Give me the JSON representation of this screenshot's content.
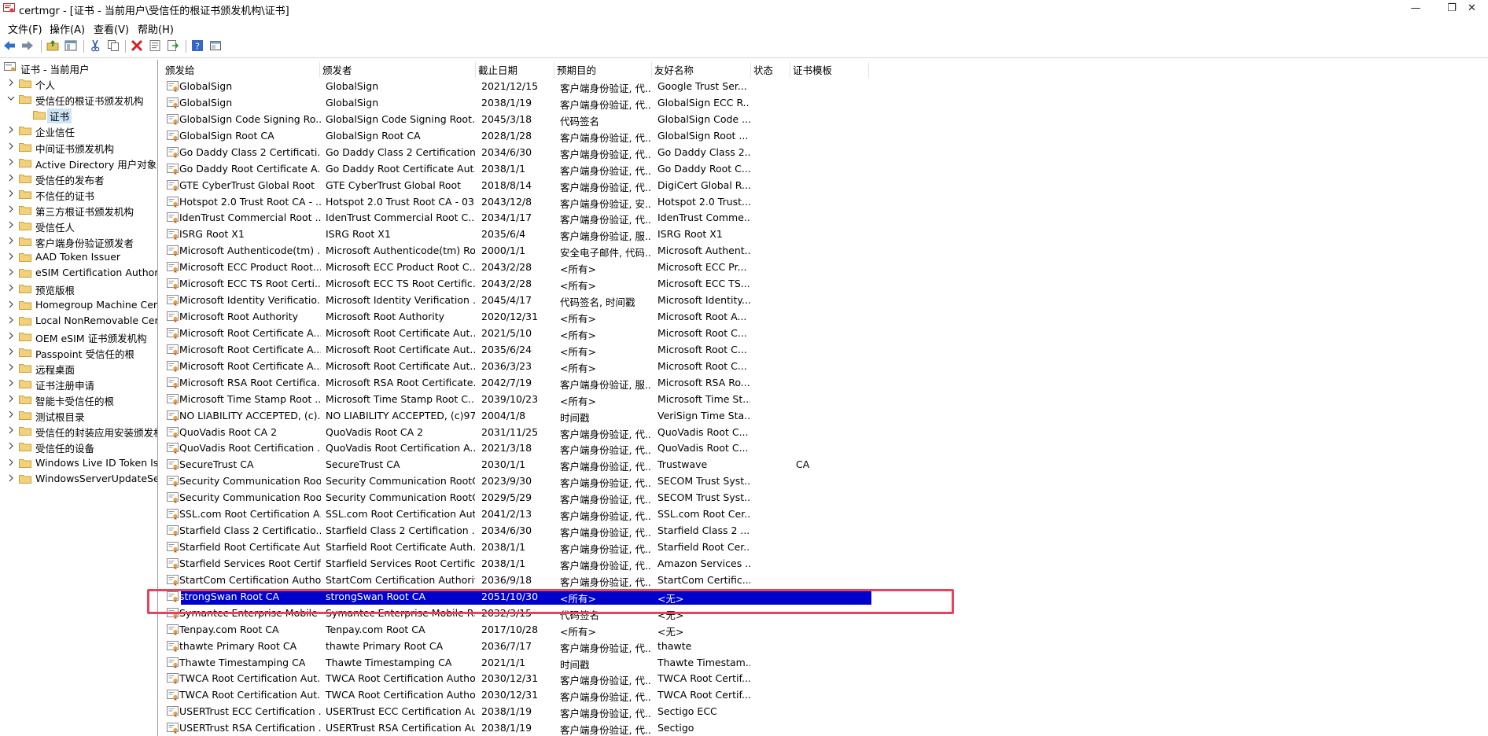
{
  "window": {
    "title": "certmgr - [证书 - 当前用户\\受信任的根证书颁发机构\\证书]",
    "controls": [
      "—",
      "❐",
      "✕"
    ]
  },
  "menu": [
    "文件(F)",
    "操作(A)",
    "查看(V)",
    "帮助(H)"
  ],
  "toolbar": {
    "icons": [
      "back-arrow-icon",
      "forward-arrow-icon",
      "up-folder-icon",
      "show-hide-tree-icon",
      "cut-icon",
      "copy-icon",
      "delete-icon",
      "properties-icon",
      "export-icon",
      "help-icon",
      "view-icon"
    ]
  },
  "tree": [
    {
      "label": "证书 - 当前用户",
      "level": 0,
      "chevron": "none",
      "folder": false,
      "selected": false
    },
    {
      "label": "个人",
      "level": 1,
      "chevron": "right",
      "folder": true,
      "selected": false
    },
    {
      "label": "受信任的根证书颁发机构",
      "level": 1,
      "chevron": "down",
      "folder": true,
      "selected": false
    },
    {
      "label": "证书",
      "level": 2,
      "chevron": "none",
      "folder": true,
      "selected": true
    },
    {
      "label": "企业信任",
      "level": 1,
      "chevron": "right",
      "folder": true,
      "selected": false
    },
    {
      "label": "中间证书颁发机构",
      "level": 1,
      "chevron": "right",
      "folder": true,
      "selected": false
    },
    {
      "label": "Active Directory 用户对象",
      "level": 1,
      "chevron": "right",
      "folder": true,
      "selected": false
    },
    {
      "label": "受信任的发布者",
      "level": 1,
      "chevron": "right",
      "folder": true,
      "selected": false
    },
    {
      "label": "不信任的证书",
      "level": 1,
      "chevron": "right",
      "folder": true,
      "selected": false
    },
    {
      "label": "第三方根证书颁发机构",
      "level": 1,
      "chevron": "right",
      "folder": true,
      "selected": false
    },
    {
      "label": "受信任人",
      "level": 1,
      "chevron": "right",
      "folder": true,
      "selected": false
    },
    {
      "label": "客户端身份验证颁发者",
      "level": 1,
      "chevron": "right",
      "folder": true,
      "selected": false
    },
    {
      "label": "AAD Token Issuer",
      "level": 1,
      "chevron": "right",
      "folder": true,
      "selected": false
    },
    {
      "label": "eSIM Certification Authoriti",
      "level": 1,
      "chevron": "right",
      "folder": true,
      "selected": false
    },
    {
      "label": "预览版根",
      "level": 1,
      "chevron": "right",
      "folder": true,
      "selected": false
    },
    {
      "label": "Homegroup Machine Cert",
      "level": 1,
      "chevron": "right",
      "folder": true,
      "selected": false
    },
    {
      "label": "Local NonRemovable Cert",
      "level": 1,
      "chevron": "right",
      "folder": true,
      "selected": false
    },
    {
      "label": "OEM eSIM 证书颁发机构",
      "level": 1,
      "chevron": "right",
      "folder": true,
      "selected": false
    },
    {
      "label": "Passpoint 受信任的根",
      "level": 1,
      "chevron": "right",
      "folder": true,
      "selected": false
    },
    {
      "label": "远程桌面",
      "level": 1,
      "chevron": "right",
      "folder": true,
      "selected": false
    },
    {
      "label": "证书注册申请",
      "level": 1,
      "chevron": "right",
      "folder": true,
      "selected": false
    },
    {
      "label": "智能卡受信任的根",
      "level": 1,
      "chevron": "right",
      "folder": true,
      "selected": false
    },
    {
      "label": "测试根目录",
      "level": 1,
      "chevron": "right",
      "folder": true,
      "selected": false
    },
    {
      "label": "受信任的封装应用安装颁发机",
      "level": 1,
      "chevron": "right",
      "folder": true,
      "selected": false
    },
    {
      "label": "受信任的设备",
      "level": 1,
      "chevron": "right",
      "folder": true,
      "selected": false
    },
    {
      "label": "Windows Live ID Token Iss",
      "level": 1,
      "chevron": "right",
      "folder": true,
      "selected": false
    },
    {
      "label": "WindowsServerUpdateSer",
      "level": 1,
      "chevron": "right",
      "folder": true,
      "selected": false
    }
  ],
  "columns": [
    "颁发给",
    "颁发者",
    "截止日期",
    "预期目的",
    "友好名称",
    "状态",
    "证书模板"
  ],
  "rows": [
    [
      "GlobalSign",
      "GlobalSign",
      "2021/12/15",
      "客户端身份验证, 代...",
      "Google Trust Ser...",
      "",
      ""
    ],
    [
      "GlobalSign",
      "GlobalSign",
      "2038/1/19",
      "客户端身份验证, 代...",
      "GlobalSign ECC R...",
      "",
      ""
    ],
    [
      "GlobalSign Code Signing Ro...",
      "GlobalSign Code Signing Root...",
      "2045/3/18",
      "代码签名",
      "GlobalSign Code ...",
      "",
      ""
    ],
    [
      "GlobalSign Root CA",
      "GlobalSign Root CA",
      "2028/1/28",
      "客户端身份验证, 代...",
      "GlobalSign Root ...",
      "",
      ""
    ],
    [
      "Go Daddy Class 2 Certificati...",
      "Go Daddy Class 2 Certification...",
      "2034/6/30",
      "客户端身份验证, 代...",
      "Go Daddy Class 2...",
      "",
      ""
    ],
    [
      "Go Daddy Root Certificate A...",
      "Go Daddy Root Certificate Aut...",
      "2038/1/1",
      "客户端身份验证, 代...",
      "Go Daddy Root C...",
      "",
      ""
    ],
    [
      "GTE CyberTrust Global Root",
      "GTE CyberTrust Global Root",
      "2018/8/14",
      "客户端身份验证, 代...",
      "DigiCert Global R...",
      "",
      ""
    ],
    [
      "Hotspot 2.0 Trust Root CA - ...",
      "Hotspot 2.0 Trust Root CA - 03",
      "2043/12/8",
      "客户端身份验证, 安...",
      "Hotspot 2.0 Trust...",
      "",
      ""
    ],
    [
      "IdenTrust Commercial Root ...",
      "IdenTrust Commercial Root C...",
      "2034/1/17",
      "客户端身份验证, 代...",
      "IdenTrust Comme...",
      "",
      ""
    ],
    [
      "ISRG Root X1",
      "ISRG Root X1",
      "2035/6/4",
      "客户端身份验证, 服...",
      "ISRG Root X1",
      "",
      ""
    ],
    [
      "Microsoft Authenticode(tm) ...",
      "Microsoft Authenticode(tm) Ro...",
      "2000/1/1",
      "安全电子邮件, 代码...",
      "Microsoft Authent...",
      "",
      ""
    ],
    [
      "Microsoft ECC Product Root...",
      "Microsoft ECC Product Root C...",
      "2043/2/28",
      "<所有>",
      "Microsoft ECC Pr...",
      "",
      ""
    ],
    [
      "Microsoft ECC TS Root Certi...",
      "Microsoft ECC TS Root Certific...",
      "2043/2/28",
      "<所有>",
      "Microsoft ECC TS...",
      "",
      ""
    ],
    [
      "Microsoft Identity Verificatio...",
      "Microsoft Identity Verification ...",
      "2045/4/17",
      "代码签名, 时间戳",
      "Microsoft Identity...",
      "",
      ""
    ],
    [
      "Microsoft Root Authority",
      "Microsoft Root Authority",
      "2020/12/31",
      "<所有>",
      "Microsoft Root A...",
      "",
      ""
    ],
    [
      "Microsoft Root Certificate A...",
      "Microsoft Root Certificate Aut...",
      "2021/5/10",
      "<所有>",
      "Microsoft Root C...",
      "",
      ""
    ],
    [
      "Microsoft Root Certificate A...",
      "Microsoft Root Certificate Aut...",
      "2035/6/24",
      "<所有>",
      "Microsoft Root C...",
      "",
      ""
    ],
    [
      "Microsoft Root Certificate A...",
      "Microsoft Root Certificate Aut...",
      "2036/3/23",
      "<所有>",
      "Microsoft Root C...",
      "",
      ""
    ],
    [
      "Microsoft RSA Root Certifica...",
      "Microsoft RSA Root Certificate...",
      "2042/7/19",
      "客户端身份验证, 服...",
      "Microsoft RSA Ro...",
      "",
      ""
    ],
    [
      "Microsoft Time Stamp Root ...",
      "Microsoft Time Stamp Root C...",
      "2039/10/23",
      "<所有>",
      "Microsoft Time St...",
      "",
      ""
    ],
    [
      "NO LIABILITY ACCEPTED, (c)...",
      "NO LIABILITY ACCEPTED, (c)97...",
      "2004/1/8",
      "时间戳",
      "VeriSign Time Sta...",
      "",
      ""
    ],
    [
      "QuoVadis Root CA 2",
      "QuoVadis Root CA 2",
      "2031/11/25",
      "客户端身份验证, 代...",
      "QuoVadis Root C...",
      "",
      ""
    ],
    [
      "QuoVadis Root Certification ...",
      "QuoVadis Root Certification A...",
      "2021/3/18",
      "客户端身份验证, 代...",
      "QuoVadis Root C...",
      "",
      ""
    ],
    [
      "SecureTrust CA",
      "SecureTrust CA",
      "2030/1/1",
      "客户端身份验证, 代...",
      "Trustwave",
      "",
      "CA"
    ],
    [
      "Security Communication Roo...",
      "Security Communication RootC...",
      "2023/9/30",
      "客户端身份验证, 代...",
      "SECOM Trust Syst...",
      "",
      ""
    ],
    [
      "Security Communication Roo...",
      "Security Communication RootC...",
      "2029/5/29",
      "客户端身份验证, 代...",
      "SECOM Trust Syst...",
      "",
      ""
    ],
    [
      "SSL.com Root Certification A...",
      "SSL.com Root Certification Aut...",
      "2041/2/13",
      "客户端身份验证, 代...",
      "SSL.com Root Cer...",
      "",
      ""
    ],
    [
      "Starfield Class 2 Certificatio...",
      "Starfield Class 2 Certification ...",
      "2034/6/30",
      "客户端身份验证, 代...",
      "Starfield Class 2 ...",
      "",
      ""
    ],
    [
      "Starfield Root Certificate Aut...",
      "Starfield Root Certificate Auth...",
      "2038/1/1",
      "客户端身份验证, 代...",
      "Starfield Root Cer...",
      "",
      ""
    ],
    [
      "Starfield Services Root Certif...",
      "Starfield Services Root Certific...",
      "2038/1/1",
      "客户端身份验证, 代...",
      "Amazon Services ...",
      "",
      ""
    ],
    [
      "StartCom Certification Autho...",
      "StartCom Certification Authority",
      "2036/9/18",
      "客户端身份验证, 代...",
      "StartCom Certific...",
      "",
      ""
    ],
    [
      "strongSwan Root CA",
      "strongSwan Root CA",
      "2051/10/30",
      "<所有>",
      "<无>",
      "",
      ""
    ],
    [
      "Symantec Enterprise Mobile ...",
      "Symantec Enterprise Mobile R...",
      "2032/3/15",
      "代码签名",
      "<无>",
      "",
      ""
    ],
    [
      "Tenpay.com Root CA",
      "Tenpay.com Root CA",
      "2017/10/28",
      "<所有>",
      "<无>",
      "",
      ""
    ],
    [
      "thawte Primary Root CA",
      "thawte Primary Root CA",
      "2036/7/17",
      "客户端身份验证, 代...",
      "thawte",
      "",
      ""
    ],
    [
      "Thawte Timestamping CA",
      "Thawte Timestamping CA",
      "2021/1/1",
      "时间戳",
      "Thawte Timestam...",
      "",
      ""
    ],
    [
      "TWCA Root Certification Aut...",
      "TWCA Root Certification Autho...",
      "2030/12/31",
      "客户端身份验证, 代...",
      "TWCA Root Certif...",
      "",
      ""
    ],
    [
      "TWCA Root Certification Aut...",
      "TWCA Root Certification Autho...",
      "2030/12/31",
      "客户端身份验证, 代...",
      "TWCA Root Certif...",
      "",
      ""
    ],
    [
      "USERTrust ECC Certification ...",
      "USERTrust ECC Certification Au...",
      "2038/1/19",
      "客户端身份验证, 代...",
      "Sectigo ECC",
      "",
      ""
    ],
    [
      "USERTrust RSA Certification ...",
      "USERTrust RSA Certification Au...",
      "2038/1/19",
      "客户端身份验证, 代...",
      "Sectigo",
      "",
      ""
    ]
  ],
  "selected_row": 31,
  "colors": {
    "selection": "#0000cc",
    "highlight_border": "#e8435c"
  }
}
